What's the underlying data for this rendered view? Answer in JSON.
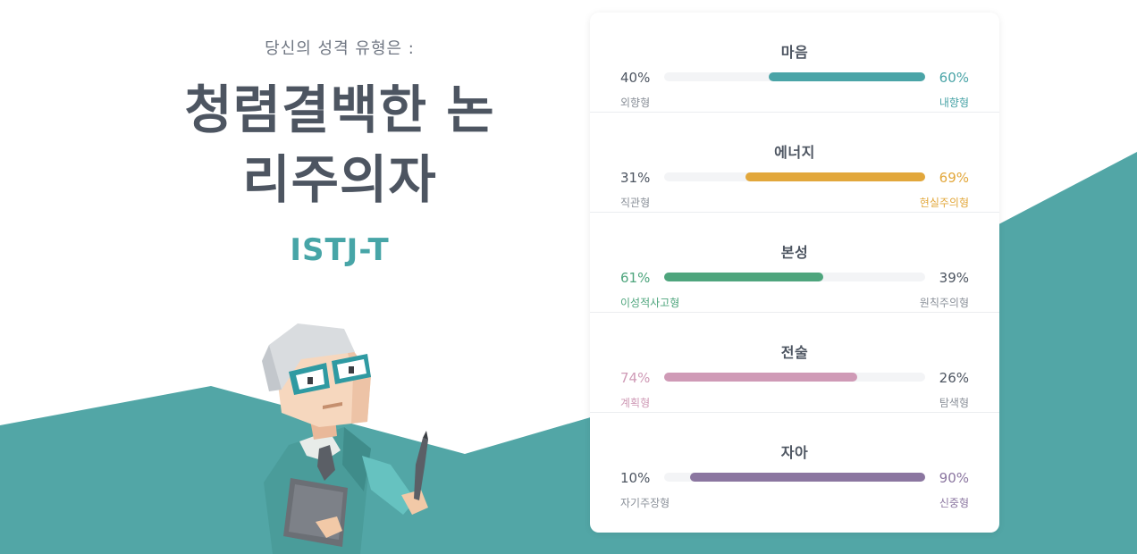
{
  "hero": {
    "kicker": "당신의 성격 유형은 :",
    "title_line1": "청렴결백한 논",
    "title_line2": "리주의자",
    "type_code": "ISTJ-T"
  },
  "colors": {
    "teal_bg": "#52a6a6",
    "mind": "#4aa4a7",
    "energy": "#e2a73b",
    "nature": "#4ea57d",
    "tactics": "#cf9ab6",
    "identity": "#8b76a0",
    "track": "#f3f4f6"
  },
  "traits": [
    {
      "title": "마음",
      "left_pct_text": "40%",
      "right_pct_text": "60%",
      "left_label": "외향형",
      "right_label": "내향형",
      "dominant": "right",
      "dominant_fraction": 0.6,
      "color_key": "mind"
    },
    {
      "title": "에너지",
      "left_pct_text": "31%",
      "right_pct_text": "69%",
      "left_label": "직관형",
      "right_label": "현실주의형",
      "dominant": "right",
      "dominant_fraction": 0.69,
      "color_key": "energy"
    },
    {
      "title": "본성",
      "left_pct_text": "61%",
      "right_pct_text": "39%",
      "left_label": "이성적사고형",
      "right_label": "원칙주의형",
      "dominant": "left",
      "dominant_fraction": 0.61,
      "color_key": "nature"
    },
    {
      "title": "전술",
      "left_pct_text": "74%",
      "right_pct_text": "26%",
      "left_label": "계획형",
      "right_label": "탐색형",
      "dominant": "left",
      "dominant_fraction": 0.74,
      "color_key": "tactics"
    },
    {
      "title": "자아",
      "left_pct_text": "10%",
      "right_pct_text": "90%",
      "left_label": "자기주장형",
      "right_label": "신중형",
      "dominant": "right",
      "dominant_fraction": 0.9,
      "color_key": "identity"
    }
  ]
}
